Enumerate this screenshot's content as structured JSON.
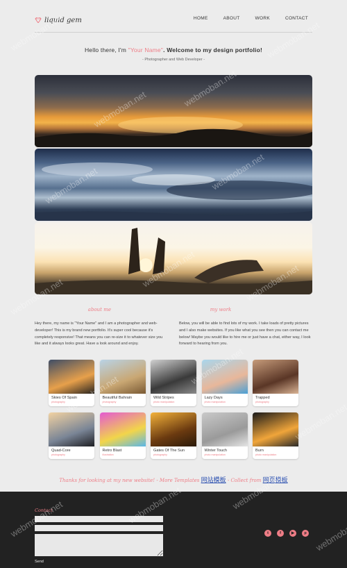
{
  "header": {
    "logo_text": "liquid gem",
    "nav": [
      "HOME",
      "ABOUT",
      "WORK",
      "CONTACT"
    ]
  },
  "intro": {
    "greeting_pre": "Hello there, I'm ",
    "name": "\"Your Name\"",
    "greeting_post": ". Welcome to my design portfolio!",
    "subtitle": "- Photographer and Web Developer -"
  },
  "about": {
    "heading": "about me",
    "text": "Hey there, my name is \"Your Name\" and I am a photographer and web-developer! This is my brand new portfolio. It's super cool because it's completely responsive! That means you can re-size it to whatever size you like and it always looks great. Have a look around and enjoy."
  },
  "work": {
    "heading": "my work",
    "text": "Below, you will be able to find lots of my work. I take loads of pretty pictures and I also make websites. If you like what you see then you can contact me below! Maybe you would like to hire me or just have a chat, either way, I look forward to hearing from you."
  },
  "gallery": [
    {
      "title": "Skies Of Spain",
      "category": "photography",
      "c1": "#3e4d66",
      "c2": "#e7a04b",
      "c3": "#2a2520"
    },
    {
      "title": "Beautiful Bahrain",
      "category": "photography",
      "c1": "#b9d3e6",
      "c2": "#c9a773",
      "c3": "#7a5a34"
    },
    {
      "title": "Wild Stripes",
      "category": "photo manipulation",
      "c1": "#d0d0d0",
      "c2": "#3a3a3a",
      "c3": "#8a8a8a"
    },
    {
      "title": "Lazy Days",
      "category": "photo manipulation",
      "c1": "#a9d6ec",
      "c2": "#e8b79a",
      "c3": "#4aa0d6"
    },
    {
      "title": "Trapped",
      "category": "photography",
      "c1": "#c69b7a",
      "c2": "#5a3626",
      "c3": "#d9b394"
    },
    {
      "title": "Quad-Core",
      "category": "photography",
      "c1": "#f2d2a2",
      "c2": "#7a8596",
      "c3": "#1e1e22"
    },
    {
      "title": "Retro Blast",
      "category": "illustration",
      "c1": "#e45ad2",
      "c2": "#f2d54a",
      "c3": "#5ab7e8"
    },
    {
      "title": "Gates Of The Sun",
      "category": "photography",
      "c1": "#f3b23a",
      "c2": "#6b3a10",
      "c3": "#2a1a0a"
    },
    {
      "title": "Winter Touch",
      "category": "photo manipulation",
      "c1": "#c9c9c9",
      "c2": "#9a9a9a",
      "c3": "#e5e5e5"
    },
    {
      "title": "Burn",
      "category": "photo manipulation",
      "c1": "#1a1a1a",
      "c2": "#f0a53a",
      "c3": "#2a2a2a"
    }
  ],
  "thanks": {
    "pre": "Thanks for looking at my new website! - More Templates",
    "link1": "网站模板",
    "mid": " - Collect from ",
    "link2": "网页模板"
  },
  "footer": {
    "heading": "Contact",
    "send_label": "Send",
    "social": [
      {
        "icon": "twitter-icon",
        "glyph": "t"
      },
      {
        "icon": "facebook-icon",
        "glyph": "f"
      },
      {
        "icon": "youtube-icon",
        "glyph": "▶"
      },
      {
        "icon": "pinterest-icon",
        "glyph": "p"
      }
    ]
  },
  "colors": {
    "accent": "#ee7d86",
    "footer_bg": "#222222",
    "page_bg": "#ececec"
  },
  "watermark": "webmoban.net"
}
